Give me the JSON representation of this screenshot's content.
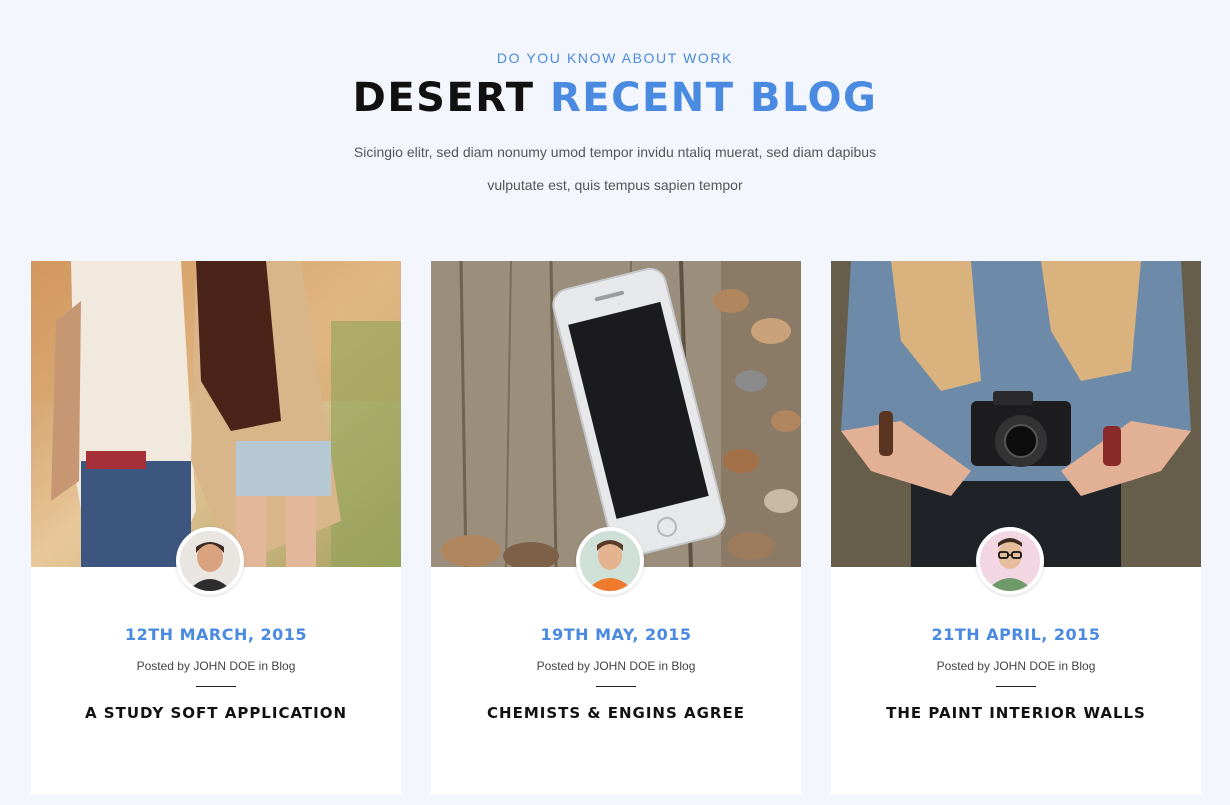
{
  "header": {
    "eyebrow": "DO YOU KNOW ABOUT WORK",
    "title_main": "DESERT",
    "title_accent": "RECENT BLOG",
    "subtitle_line1": "Sicingio elitr, sed diam nonumy umod tempor invidu ntaliq muerat, sed diam dapibus",
    "subtitle_line2": "vulputate est, quis tempus sapien tempor"
  },
  "colors": {
    "accent": "#4a8ae0",
    "background": "#f3f6fd",
    "card": "#ffffff",
    "text": "#111111"
  },
  "posts": [
    {
      "date": "12TH MARCH, 2015",
      "posted_prefix": "Posted by",
      "author": "JOHN DOE",
      "in_word": "in",
      "category": "Blog",
      "title": "A STUDY SOFT APPLICATION",
      "image": "couple-photo",
      "avatar": "man-avatar"
    },
    {
      "date": "19TH MAY, 2015",
      "posted_prefix": "Posted by",
      "author": "JOHN DOE",
      "in_word": "in",
      "category": "Blog",
      "title": "CHEMISTS & ENGINS AGREE",
      "image": "smartphone-photo",
      "avatar": "child-avatar"
    },
    {
      "date": "21TH APRIL, 2015",
      "posted_prefix": "Posted by",
      "author": "JOHN DOE",
      "in_word": "in",
      "category": "Blog",
      "title": "THE PAINT INTERIOR WALLS",
      "image": "camera-photo",
      "avatar": "glasses-man-avatar"
    }
  ]
}
